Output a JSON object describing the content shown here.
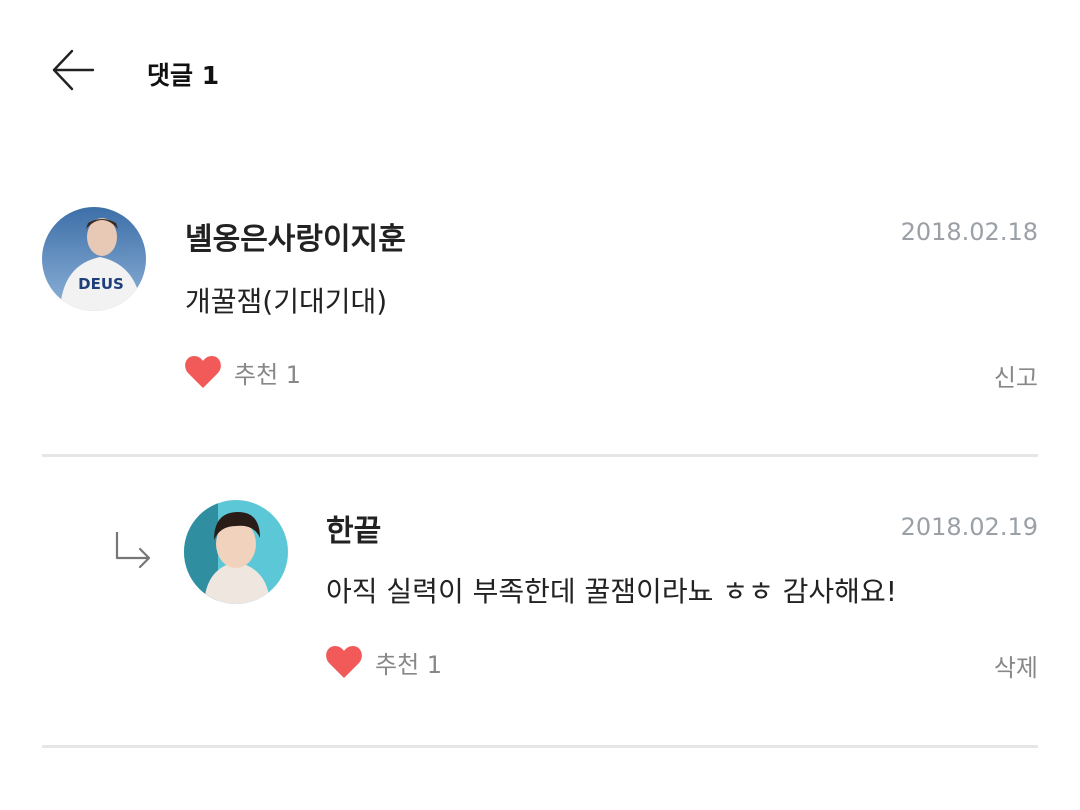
{
  "header": {
    "title": "댓글 1",
    "back_icon": "arrow-left-icon"
  },
  "comments": [
    {
      "author": "녤옹은사랑이지훈",
      "date": "2018.02.18",
      "text": "개꿀잼(기대기대)",
      "like_label": "추천 1",
      "action_label": "신고",
      "avatar_shirt_text": "DEUS"
    },
    {
      "author": "한끝",
      "date": "2018.02.19",
      "text": "아직 실력이 부족한데 꿀잼이라뇨 ㅎㅎ 감사해요!",
      "like_label": "추천 1",
      "action_label": "삭제",
      "is_reply": true
    }
  ],
  "colors": {
    "heart": "#f25a5a",
    "meta_gray": "#888888",
    "date_gray": "#9aa0a6",
    "divider": "#e6e6e6"
  }
}
